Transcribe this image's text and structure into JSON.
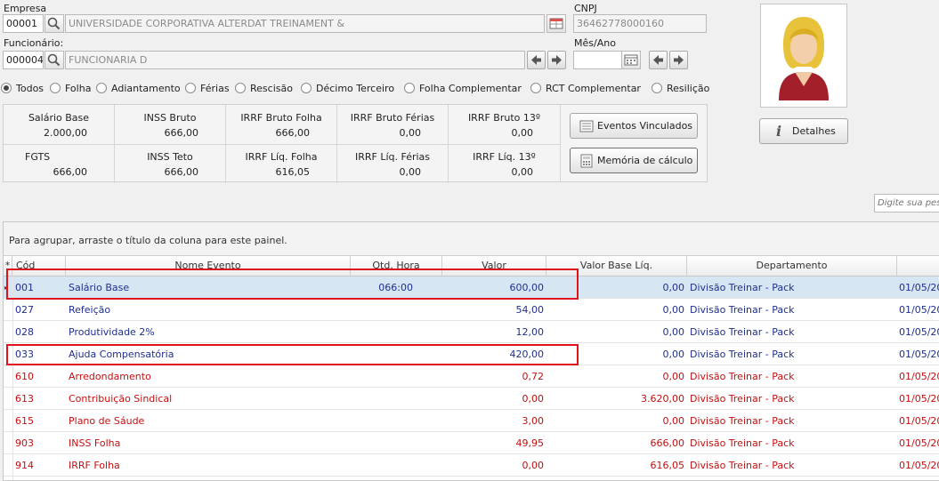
{
  "empresa": {
    "label": "Empresa",
    "code": "00001",
    "name": "UNIVERSIDADE CORPORATIVA ALTERDAT TREINAMENT &"
  },
  "cnpj": {
    "label": "CNPJ",
    "value": "36462778000160"
  },
  "funcionario": {
    "label": "Funcionário:",
    "code": "000004",
    "name": "FUNCIONARIA D"
  },
  "mes_ano": {
    "label": "Mês/Ano",
    "value": ""
  },
  "filters": [
    {
      "label": "Todos",
      "checked": true
    },
    {
      "label": "Folha",
      "checked": false
    },
    {
      "label": "Adiantamento",
      "checked": false
    },
    {
      "label": "Férias",
      "checked": false
    },
    {
      "label": "Rescisão",
      "checked": false
    },
    {
      "label": "Décimo Terceiro",
      "checked": false
    },
    {
      "label": "Folha Complementar",
      "checked": false
    },
    {
      "label": "RCT Complementar",
      "checked": false
    },
    {
      "label": "Resilição",
      "checked": false
    }
  ],
  "summary": [
    {
      "title": "Salário Base",
      "value": "2.000,00"
    },
    {
      "title": "INSS Bruto",
      "value": "666,00"
    },
    {
      "title": "IRRF Bruto Folha",
      "value": "666,00"
    },
    {
      "title": "IRRF Bruto Férias",
      "value": "0,00"
    },
    {
      "title": "IRRF Bruto 13º",
      "value": "0,00"
    },
    {
      "title": "FGTS",
      "value": "666,00"
    },
    {
      "title": "INSS Teto",
      "value": "666,00"
    },
    {
      "title": "IRRF Líq. Folha",
      "value": "616,05"
    },
    {
      "title": "IRRF Líq. Férias",
      "value": "0,00"
    },
    {
      "title": "IRRF Líq. 13º",
      "value": "0,00"
    }
  ],
  "buttons": {
    "eventos_vinculados": "Eventos Vinculados",
    "memoria_calculo": "Memória de cálculo",
    "detalhes": "Detalhes"
  },
  "search": {
    "placeholder": "Digite sua pesq"
  },
  "grid": {
    "group_hint": "Para agrupar, arraste o título da coluna para este painel.",
    "columns": [
      "Cód",
      "Nome Evento",
      "Qtd. Hora",
      "Valor",
      "Valor Base Líq.",
      "Departamento",
      ""
    ],
    "rows": [
      {
        "cod": "001",
        "nome": "Salário Base",
        "qtd": "066:00",
        "valor": "600,00",
        "base": "0,00",
        "dep": "Divisão Treinar - Pack",
        "data": "01/05/20",
        "type": "blue"
      },
      {
        "cod": "027",
        "nome": "Refeição",
        "qtd": "",
        "valor": "54,00",
        "base": "0,00",
        "dep": "Divisão Treinar - Pack",
        "data": "01/05/20",
        "type": "blue"
      },
      {
        "cod": "028",
        "nome": "Produtividade 2%",
        "qtd": "",
        "valor": "12,00",
        "base": "0,00",
        "dep": "Divisão Treinar - Pack",
        "data": "01/05/20",
        "type": "blue"
      },
      {
        "cod": "033",
        "nome": "Ajuda Compensatória",
        "qtd": "",
        "valor": "420,00",
        "base": "0,00",
        "dep": "Divisão Treinar - Pack",
        "data": "01/05/20",
        "type": "blue"
      },
      {
        "cod": "610",
        "nome": "Arredondamento",
        "qtd": "",
        "valor": "0,72",
        "base": "0,00",
        "dep": "Divisão Treinar - Pack",
        "data": "01/05/20",
        "type": "red"
      },
      {
        "cod": "613",
        "nome": "Contribuição Sindical",
        "qtd": "",
        "valor": "0,00",
        "base": "3.620,00",
        "dep": "Divisão Treinar - Pack",
        "data": "01/05/20",
        "type": "red"
      },
      {
        "cod": "615",
        "nome": "Plano de Sáude",
        "qtd": "",
        "valor": "3,00",
        "base": "0,00",
        "dep": "Divisão Treinar - Pack",
        "data": "01/05/20",
        "type": "red"
      },
      {
        "cod": "903",
        "nome": "INSS Folha",
        "qtd": "",
        "valor": "49,95",
        "base": "666,00",
        "dep": "Divisão Treinar - Pack",
        "data": "01/05/20",
        "type": "red"
      },
      {
        "cod": "914",
        "nome": "IRRF Folha",
        "qtd": "",
        "valor": "0,00",
        "base": "616,05",
        "dep": "Divisão Treinar - Pack",
        "data": "01/05/20",
        "type": "red"
      }
    ]
  },
  "colors": {
    "blue_text": "#1f2f8f",
    "red_text": "#c41010",
    "highlight": "#e0121b",
    "selected_row": "#d7e6f3"
  }
}
